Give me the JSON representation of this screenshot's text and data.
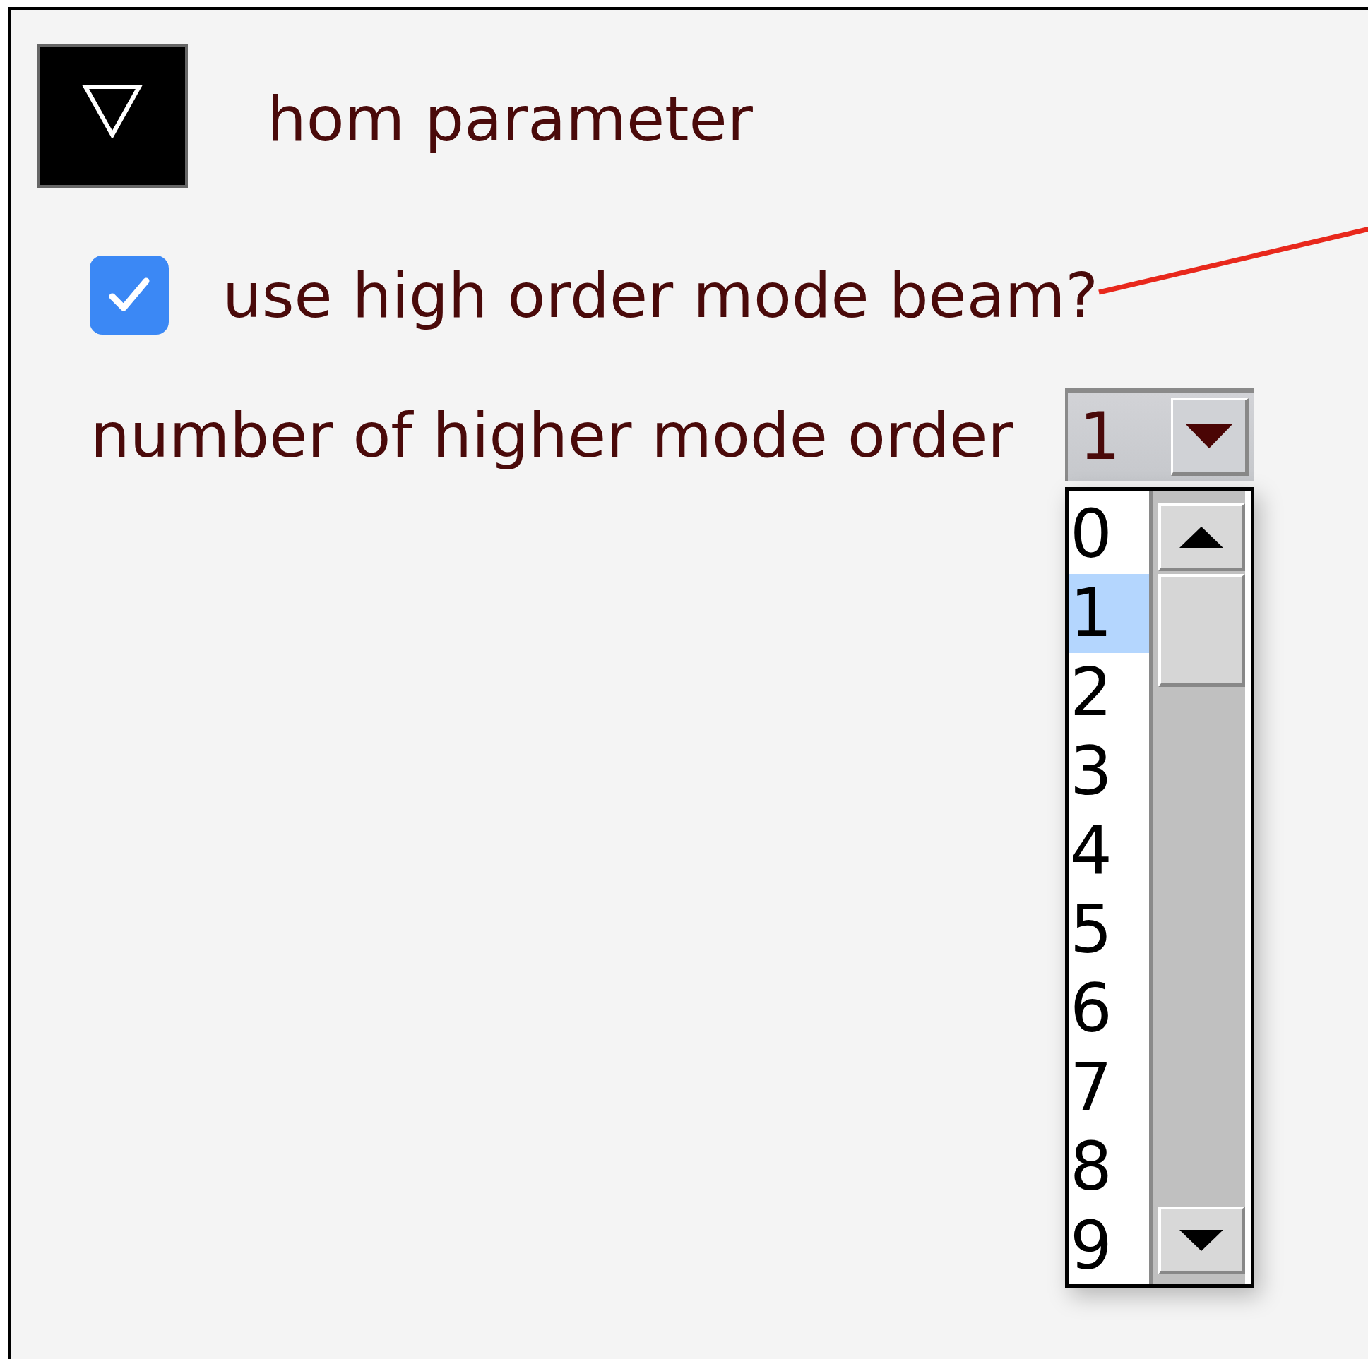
{
  "section": {
    "title": "hom parameter",
    "expanded": true
  },
  "checkbox": {
    "label": "use high order mode beam?",
    "checked": true
  },
  "select": {
    "label": "number of higher mode order",
    "value": "1",
    "open": true,
    "options": [
      {
        "label": "0",
        "selected": false
      },
      {
        "label": "1",
        "selected": true
      },
      {
        "label": "2",
        "selected": false
      },
      {
        "label": "3",
        "selected": false
      },
      {
        "label": "4",
        "selected": false
      },
      {
        "label": "5",
        "selected": false
      },
      {
        "label": "6",
        "selected": false
      },
      {
        "label": "7",
        "selected": false
      },
      {
        "label": "8",
        "selected": false
      },
      {
        "label": "9",
        "selected": false
      }
    ]
  }
}
